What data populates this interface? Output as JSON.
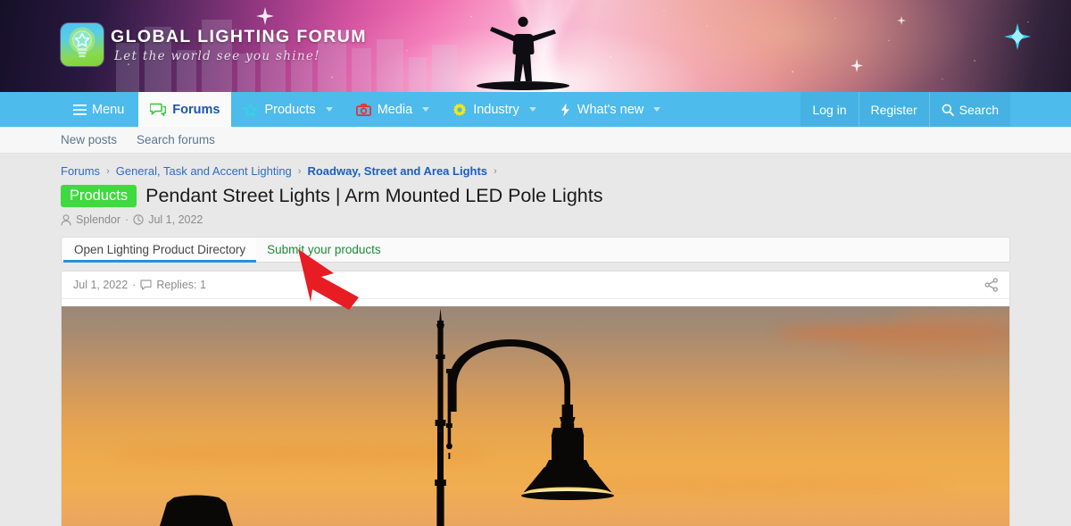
{
  "banner": {
    "brand_title": "GLOBAL LIGHTING FORUM",
    "tagline": "Let the world see you shine!",
    "logo_icon": "lightbulb-star-logo",
    "silhouette_icon": "person-arms-outstretched-silhouette"
  },
  "nav": {
    "menu_label": "Menu",
    "menu_icon": "hamburger-icon",
    "items": [
      {
        "label": "Forums",
        "icon": "speech-bubbles-icon",
        "icon_color": "#3dc43d",
        "active": true,
        "has_caret": false
      },
      {
        "label": "Products",
        "icon": "star-outline-icon",
        "icon_color": "#34d3e8",
        "active": false,
        "has_caret": true
      },
      {
        "label": "Media",
        "icon": "camera-icon",
        "icon_color": "#ef2b2b",
        "active": false,
        "has_caret": true
      },
      {
        "label": "Industry",
        "icon": "gear-icon",
        "icon_color": "#f2e61c",
        "active": false,
        "has_caret": true
      },
      {
        "label": "What's new",
        "icon": "lightning-bolt-icon",
        "icon_color": "#ffffff",
        "active": false,
        "has_caret": true
      }
    ],
    "login_label": "Log in",
    "register_label": "Register",
    "search_label": "Search",
    "search_icon": "magnifier-icon",
    "bar_color": "#4dbbeb"
  },
  "subnav": {
    "items": [
      {
        "label": "New posts"
      },
      {
        "label": "Search forums"
      }
    ]
  },
  "breadcrumb": {
    "items": [
      {
        "label": "Forums",
        "current": false
      },
      {
        "label": "General, Task and Accent Lighting",
        "current": false
      },
      {
        "label": "Roadway, Street and Area Lights",
        "current": true
      }
    ],
    "separator": "›"
  },
  "thread": {
    "badge": "Products",
    "badge_color": "#3ddb3d",
    "title": "Pendant Street Lights | Arm Mounted LED Pole Lights",
    "author_icon": "person-icon",
    "author": "Splendor",
    "separator": "·",
    "date_icon": "clock-icon",
    "date": "Jul 1, 2022"
  },
  "tabs": [
    {
      "label": "Open Lighting Product Directory",
      "active": true
    },
    {
      "label": "Submit your products",
      "active": false
    }
  ],
  "post": {
    "date": "Jul 1, 2022",
    "separator": "·",
    "replies_icon": "speech-bubble-icon",
    "replies_label": "Replies: 1",
    "share_icon": "share-icon",
    "image_alt": "street-lamp-sunset-silhouette"
  },
  "annotation": {
    "arrow_icon": "red-arrow-pointer",
    "arrow_color": "#e81c23"
  }
}
